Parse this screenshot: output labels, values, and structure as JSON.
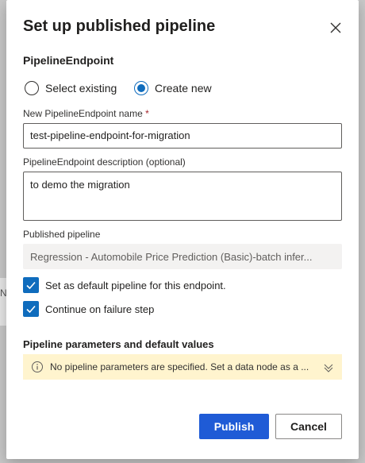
{
  "dialog": {
    "title": "Set up published pipeline",
    "section_label": "PipelineEndpoint",
    "radio_options": [
      {
        "label": "Select existing",
        "selected": false
      },
      {
        "label": "Create new",
        "selected": true
      }
    ],
    "name_field": {
      "label": "New PipelineEndpoint name",
      "required_mark": "*",
      "value": "test-pipeline-endpoint-for-migration"
    },
    "description_field": {
      "label": "PipelineEndpoint description (optional)",
      "value": "to demo the migration"
    },
    "published_pipeline": {
      "label": "Published pipeline",
      "value": "Regression - Automobile Price Prediction (Basic)-batch infer..."
    },
    "checkboxes": [
      {
        "label": "Set as default pipeline for this endpoint.",
        "checked": true
      },
      {
        "label": "Continue on failure step",
        "checked": true
      }
    ],
    "parameters": {
      "title": "Pipeline parameters and default values",
      "message": "No pipeline parameters are specified. Set a data node as a ..."
    },
    "buttons": {
      "publish": "Publish",
      "cancel": "Cancel"
    }
  },
  "backdrop": {
    "edge_char": "N"
  },
  "colors": {
    "accent": "#0f6cbd",
    "primary_button": "#1f5bd6",
    "warning_background": "#fff4ce"
  }
}
